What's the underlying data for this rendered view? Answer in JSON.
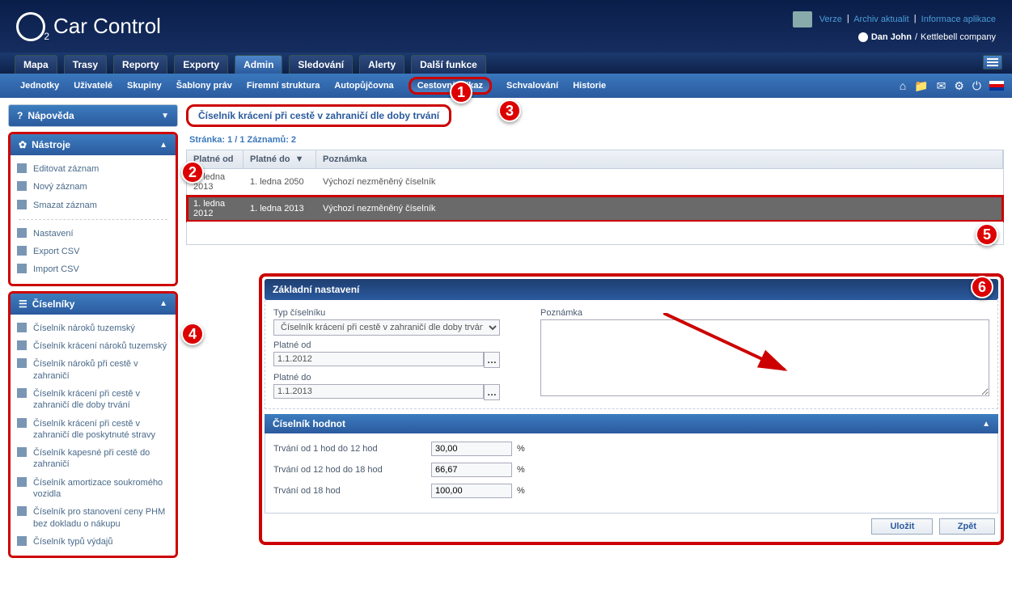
{
  "header": {
    "app_name": "Car Control",
    "links": {
      "verze": "Verze",
      "archiv": "Archiv aktualit",
      "info": "Informace aplikace"
    },
    "user_name": "Dan John",
    "company": "Kettlebell company"
  },
  "tabs": [
    "Mapa",
    "Trasy",
    "Reporty",
    "Exporty",
    "Admin",
    "Sledování",
    "Alerty",
    "Další funkce"
  ],
  "active_tab": 4,
  "subnav": [
    "Jednotky",
    "Uživatelé",
    "Skupiny",
    "Šablony práv",
    "Firemní struktura",
    "Autopůjčovna",
    "Cestovní příkaz",
    "Schvalování",
    "Historie"
  ],
  "subnav_hilite": 6,
  "sidebar": {
    "help_title": "Nápověda",
    "tools_title": "Nástroje",
    "tools_items": [
      "Editovat záznam",
      "Nový záznam",
      "Smazat záznam"
    ],
    "tools_items2": [
      "Nastavení",
      "Export CSV",
      "Import CSV"
    ],
    "lists_title": "Číselníky",
    "lists_items": [
      "Číselník nároků tuzemský",
      "Číselník krácení nároků tuzemský",
      "Číselník nároků při cestě v zahraničí",
      "Číselník krácení při cestě v zahraničí dle doby trvání",
      "Číselník krácení při cestě v zahraničí dle poskytnuté stravy",
      "Číselník kapesné při cestě do zahraničí",
      "Číselník amortizace soukromého vozidla",
      "Číselník pro stanovení ceny PHM bez dokladu o nákupu",
      "Číselník typů výdajů"
    ]
  },
  "content": {
    "title": "Číselník krácení při cestě v zahraničí dle doby trvání",
    "page_stats": "Stránka: 1 / 1  Záznamů: 2",
    "columns": {
      "c1": "Platné od",
      "c2": "Platné do",
      "c3": "Poznámka"
    },
    "rows": [
      {
        "from": "1. ledna 2013",
        "to": "1. ledna 2050",
        "note": "Výchozí nezměněný číselník"
      },
      {
        "from": "1. ledna 2012",
        "to": "1. ledna 2013",
        "note": "Výchozí nezměněný číselník"
      }
    ],
    "form": {
      "header": "Základní nastavení",
      "type_label": "Typ číselníku",
      "type_value": "Číselník krácení při cestě v zahraničí dle doby trvání",
      "from_label": "Platné od",
      "from_value": "1.1.2012",
      "to_label": "Platné do",
      "to_value": "1.1.2013",
      "note_label": "Poznámka"
    },
    "values": {
      "header": "Číselník hodnot",
      "rows": [
        {
          "label": "Trvání od 1 hod do 12 hod",
          "value": "30,00"
        },
        {
          "label": "Trvání od 12 hod do 18 hod",
          "value": "66,67"
        },
        {
          "label": "Trvání od 18 hod",
          "value": "100,00"
        }
      ],
      "pct": "%"
    },
    "buttons": {
      "save": "Uložit",
      "back": "Zpět"
    }
  },
  "callouts": {
    "c1": "1",
    "c2": "2",
    "c3": "3",
    "c4": "4",
    "c5": "5",
    "c6": "6"
  }
}
